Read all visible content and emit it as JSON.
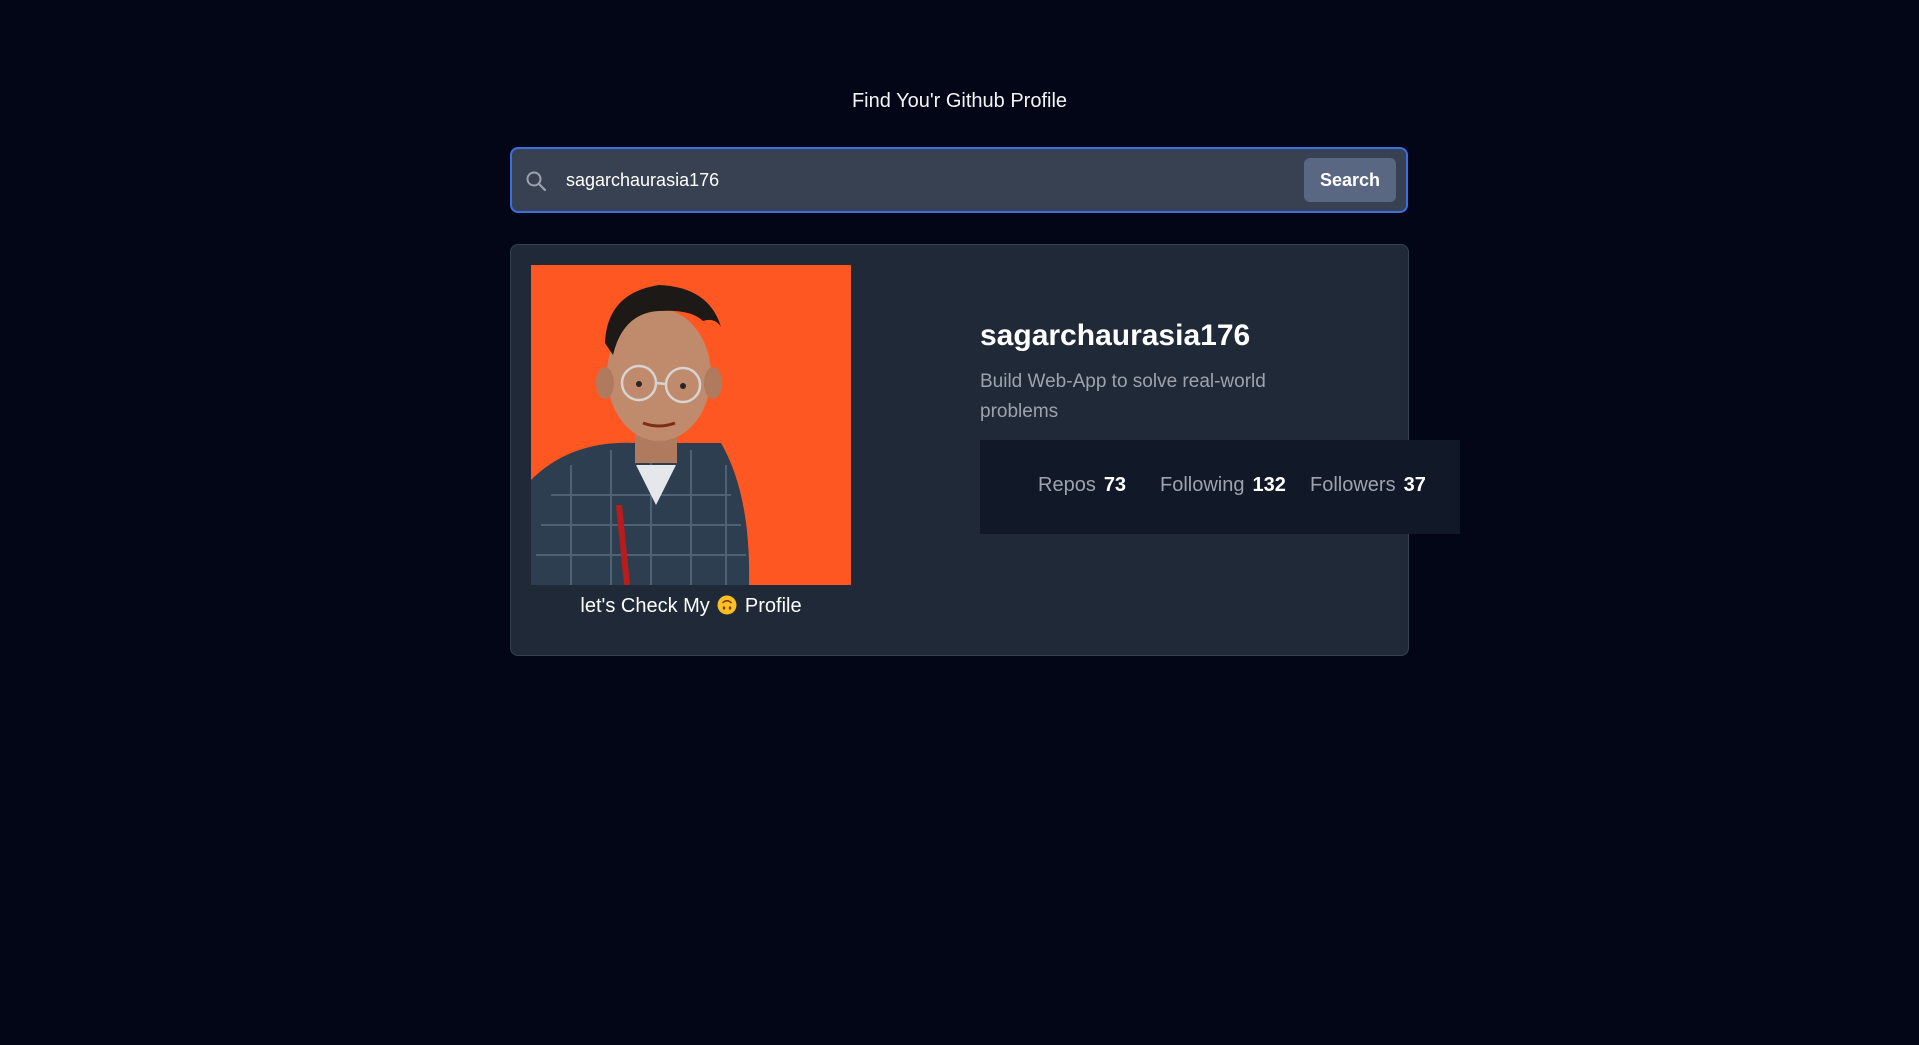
{
  "page": {
    "title": "Find You'r Github Profile"
  },
  "search": {
    "value": "sagarchaurasia176",
    "button_label": "Search",
    "icon": "search-icon"
  },
  "profile": {
    "avatar_background": "#ff5722",
    "link_prefix": "let's Check My",
    "link_emoji": "upside-down-face-icon",
    "link_suffix": "Profile",
    "username": "sagarchaurasia176",
    "bio": "Build Web-App to solve real-world problems",
    "stats": [
      {
        "label": "Repos",
        "value": "73"
      },
      {
        "label": "Following",
        "value": "132"
      },
      {
        "label": "Followers",
        "value": "37"
      }
    ]
  },
  "colors": {
    "background": "#030617",
    "card": "#1f2937",
    "search_bar": "#374151",
    "search_border": "#3b6fe0",
    "button": "#5a6782",
    "stats_panel": "#111827"
  }
}
